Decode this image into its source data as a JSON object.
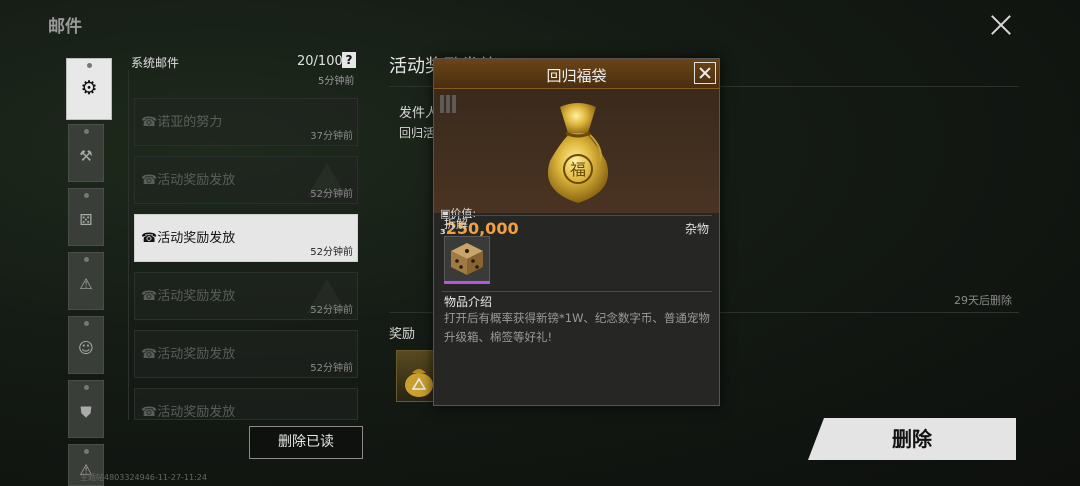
{
  "header": {
    "title": "邮件"
  },
  "categories": [
    {
      "icon": "gear-icon",
      "glyph": "⚙",
      "active": true
    },
    {
      "icon": "hammer-icon",
      "glyph": "⚒",
      "active": false
    },
    {
      "icon": "dice-icon",
      "glyph": "⚄",
      "active": false
    },
    {
      "icon": "warning-icon",
      "glyph": "⚠",
      "active": false
    },
    {
      "icon": "character-icon",
      "glyph": "☺",
      "active": false
    },
    {
      "icon": "backpack-icon",
      "glyph": "⛊",
      "active": false
    },
    {
      "icon": "alert-icon",
      "glyph": "⚠",
      "active": false
    }
  ],
  "mail_list": {
    "header": "系统邮件",
    "count": "20/100",
    "help": "?",
    "first_time": "5分钟前",
    "items": [
      {
        "title": "诺亚的努力",
        "time": "37分钟前",
        "active": false
      },
      {
        "title": "活动奖励发放",
        "time": "52分钟前",
        "active": false
      },
      {
        "title": "活动奖励发放",
        "time": "52分钟前",
        "active": true
      },
      {
        "title": "活动奖励发放",
        "time": "52分钟前",
        "active": false
      },
      {
        "title": "活动奖励发放",
        "time": "52分钟前",
        "active": false
      },
      {
        "title": "活动奖励发放",
        "time": "",
        "active": false
      }
    ],
    "delete_read_label": "删除已读"
  },
  "detail": {
    "title": "活动奖励发放",
    "sender_label": "发件人",
    "sender_name": "回归活",
    "expire": "29天后删除",
    "reward_label": "奖励",
    "delete_label": "删除"
  },
  "popup": {
    "title": "回归福袋",
    "value_label": "价值:",
    "value": "250,000",
    "category": "杂物",
    "disassemble_label": "拆解",
    "desc_title": "物品介绍",
    "description": "打开后有概率获得新镑*1W、纪念数字币、普通宠物升级箱、棉签等好礼!"
  },
  "watermark": "主题帖4803324946-11-27-11:24",
  "colors": {
    "accent_orange": "#f0a040",
    "rarity_purple": "#b455e0",
    "popup_header": "#6b4418"
  }
}
